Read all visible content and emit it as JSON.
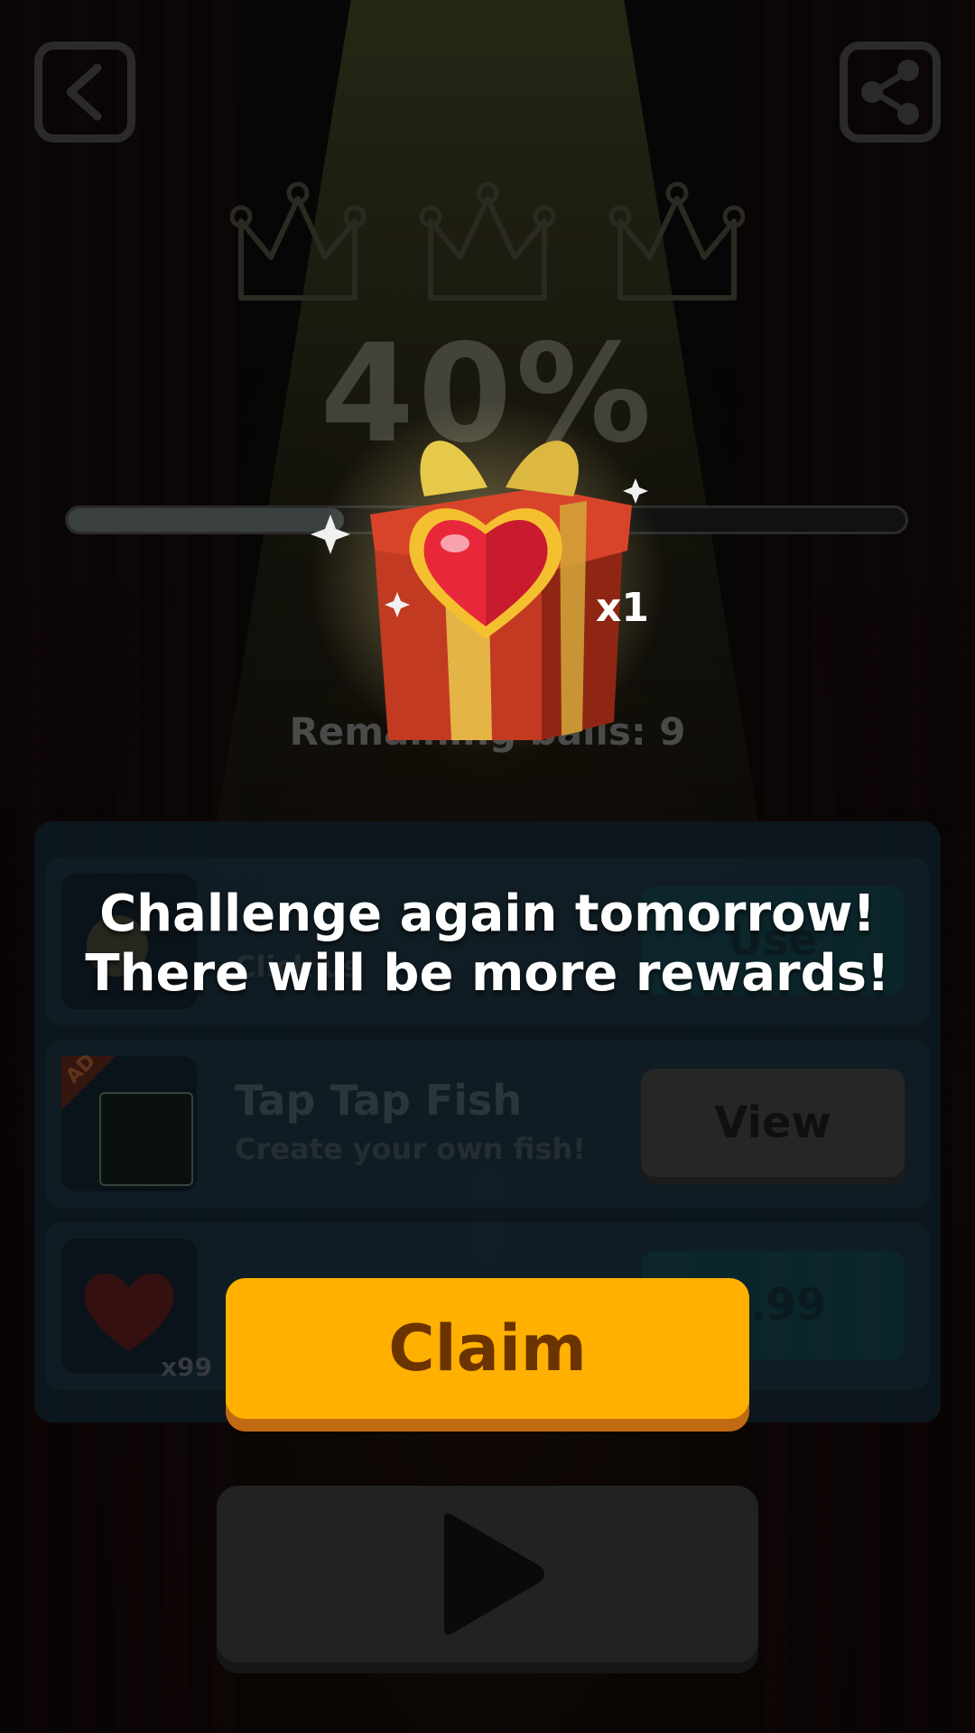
{
  "progress": {
    "percent_text": "40%",
    "fill_fraction": 0.33
  },
  "remaining_balls_text": "Remaining balls: 9",
  "reward": {
    "item": "heart",
    "count_text": "x1"
  },
  "message": {
    "line1": "Challenge again tomorrow!",
    "line2": "There will be more rewards!"
  },
  "shop": {
    "rows": [
      {
        "title": "",
        "subtitle": "Click us",
        "button": "Use",
        "icon": "ball-icon"
      },
      {
        "badge": "AD",
        "title": "Tap Tap Fish",
        "subtitle": "Create your own fish!",
        "button": "View",
        "icon": "fish-app-icon"
      },
      {
        "title": "",
        "subtitle": "",
        "button": "9.99",
        "count": "x99",
        "icon": "heart-icon"
      }
    ]
  },
  "claim_button": "Claim",
  "colors": {
    "claim": "#ffb000",
    "claim_text": "#6b3300",
    "heart": "#e8283a",
    "gold": "#f5c030"
  }
}
